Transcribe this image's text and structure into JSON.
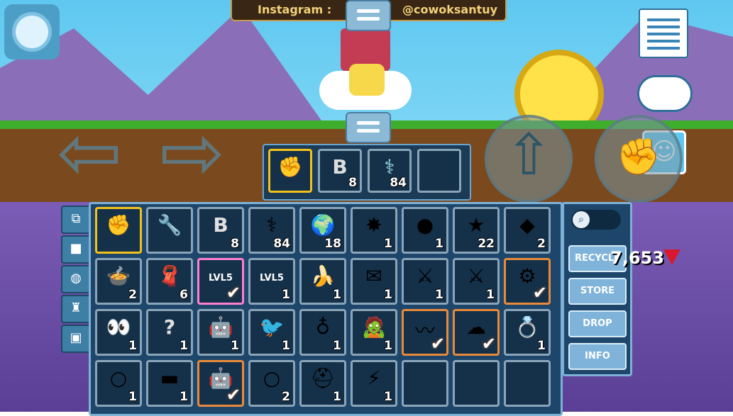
{
  "banner": {
    "left_text": "Instagram :",
    "right_text": "@cowoksantuy"
  },
  "hud": {
    "pause_icon": "pause-icon",
    "menu_icon": "list-icon",
    "chat_icon": "chat-bubble-icon",
    "emote_icon": "smiley-face-icon"
  },
  "hotbar": [
    {
      "icon": "fist-icon",
      "glyph": "✊",
      "qty": "",
      "selected": true
    },
    {
      "icon": "blueprint-b-icon",
      "glyph": "B",
      "qty": "8"
    },
    {
      "icon": "caduceus-icon",
      "glyph": "⚕",
      "qty": "84"
    },
    {
      "icon": "empty-slot",
      "glyph": "",
      "qty": ""
    }
  ],
  "gems": {
    "value": "7,653"
  },
  "side_buttons": [
    "RECYCLE",
    "STORE",
    "DROP",
    "INFO"
  ],
  "inventory": [
    [
      {
        "icon": "fist-icon",
        "glyph": "✊",
        "qty": "",
        "state": "sel"
      },
      {
        "icon": "wrench-icon",
        "glyph": "🔧",
        "qty": ""
      },
      {
        "icon": "blueprint-b-icon",
        "glyph": "B",
        "qty": "8"
      },
      {
        "icon": "caduceus-icon",
        "glyph": "⚕",
        "qty": "84"
      },
      {
        "icon": "green-planet-icon",
        "glyph": "🌍",
        "qty": "18"
      },
      {
        "icon": "starburst-icon",
        "glyph": "✸",
        "qty": "1"
      },
      {
        "icon": "gold-orb-icon",
        "glyph": "●",
        "qty": "1"
      },
      {
        "icon": "blue-star-icon",
        "glyph": "★",
        "qty": "22"
      },
      {
        "icon": "purple-crystal-icon",
        "glyph": "◆",
        "qty": "2"
      }
    ],
    [
      {
        "icon": "cauldron-icon",
        "glyph": "🍲",
        "qty": "2"
      },
      {
        "icon": "orange-cloth-icon",
        "glyph": "🧣",
        "qty": "6"
      },
      {
        "icon": "lvl5-box-icon",
        "glyph": "LVL5",
        "qty": "",
        "state": "pink",
        "check": true
      },
      {
        "icon": "lvl5-rocket-icon",
        "glyph": "LVL5",
        "qty": "1"
      },
      {
        "icon": "golden-banana-icon",
        "glyph": "🍌",
        "qty": "1"
      },
      {
        "icon": "paper-note-icon",
        "glyph": "✉",
        "qty": "1"
      },
      {
        "icon": "sword-icon",
        "glyph": "⚔",
        "qty": "1"
      },
      {
        "icon": "dark-sword-icon",
        "glyph": "⚔",
        "qty": "1"
      },
      {
        "icon": "gear-device-icon",
        "glyph": "⚙",
        "qty": "",
        "state": "check",
        "check": true
      }
    ],
    [
      {
        "icon": "eyes-icon",
        "glyph": "👀",
        "qty": "1"
      },
      {
        "icon": "mystery-shirt-icon",
        "glyph": "?",
        "qty": "1"
      },
      {
        "icon": "robot-head-icon",
        "glyph": "🤖",
        "qty": "1"
      },
      {
        "icon": "bird-icon",
        "glyph": "🐦",
        "qty": "1"
      },
      {
        "icon": "necklace-icon",
        "glyph": "♁",
        "qty": "1"
      },
      {
        "icon": "zombie-icon",
        "glyph": "🧟",
        "qty": "1"
      },
      {
        "icon": "whip-icon",
        "glyph": "〰",
        "qty": "",
        "state": "check",
        "check": true
      },
      {
        "icon": "cloud-face-icon",
        "glyph": "☁",
        "qty": "",
        "state": "check",
        "check": true
      },
      {
        "icon": "ring-icon",
        "glyph": "💍",
        "qty": "1"
      }
    ],
    [
      {
        "icon": "purple-ring-icon",
        "glyph": "○",
        "qty": "1"
      },
      {
        "icon": "rifle-icon",
        "glyph": "▬",
        "qty": "1"
      },
      {
        "icon": "robot-glasses-icon",
        "glyph": "🤖",
        "qty": "",
        "state": "check",
        "check": true
      },
      {
        "icon": "gold-ring-icon",
        "glyph": "○",
        "qty": "2"
      },
      {
        "icon": "hardhat-icon",
        "glyph": "⛑",
        "qty": "1"
      },
      {
        "icon": "lightning-bolt-icon",
        "glyph": "⚡",
        "qty": "1"
      },
      {
        "icon": "empty-slot",
        "glyph": "",
        "qty": ""
      },
      {
        "icon": "empty-slot",
        "glyph": "",
        "qty": ""
      },
      {
        "icon": "empty-slot",
        "glyph": "",
        "qty": ""
      }
    ]
  ]
}
